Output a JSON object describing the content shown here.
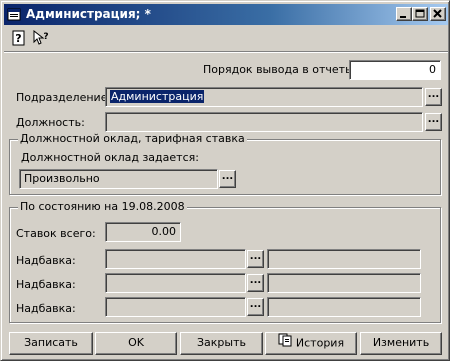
{
  "window": {
    "title": "Администрация; *"
  },
  "toolbar": {
    "help_icon": "help-book-icon",
    "context_help_icon": "context-help-icon"
  },
  "form": {
    "order_label": "Порядок вывода в отчеты:",
    "order_value": "0",
    "division_label": "Подразделение:",
    "division_value": "Администрация",
    "position_label": "Должность:",
    "position_value": ""
  },
  "salary_group": {
    "title": "Должностной оклад, тарифная ставка",
    "defined_label": "Должностной оклад задается:",
    "defined_value": "Произвольно"
  },
  "state_group": {
    "title": "По состоянию на 19.08.2008",
    "rates_label": "Ставок всего:",
    "rates_value": "0.00",
    "allowances": [
      {
        "label": "Надбавка:",
        "value": "",
        "extra": ""
      },
      {
        "label": "Надбавка:",
        "value": "",
        "extra": ""
      },
      {
        "label": "Надбавка:",
        "value": "",
        "extra": ""
      }
    ]
  },
  "buttons": {
    "save": "Записать",
    "ok": "OK",
    "close": "Закрыть",
    "history": "История",
    "edit": "Изменить"
  },
  "colors": {
    "titlebar_start": "#0a246a",
    "titlebar_end": "#a6caf0",
    "face": "#d4d0c8"
  }
}
